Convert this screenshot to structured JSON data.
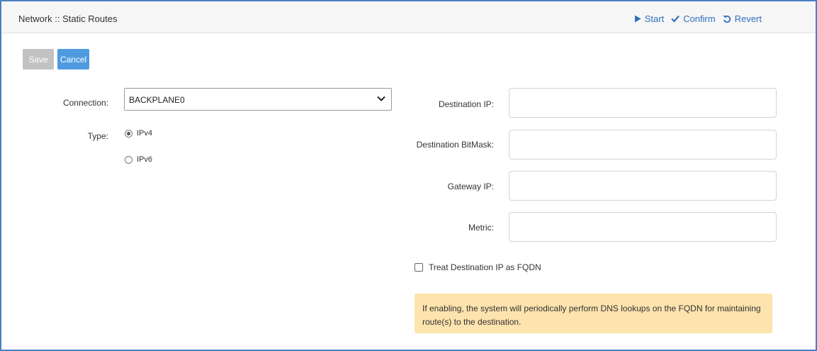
{
  "header": {
    "title": "Network :: Static Routes",
    "actions": [
      {
        "label": "Start",
        "icon": "play-icon"
      },
      {
        "label": "Confirm",
        "icon": "check-icon"
      },
      {
        "label": "Revert",
        "icon": "revert-icon"
      }
    ]
  },
  "toolbar": {
    "save_label": "Save",
    "cancel_label": "Cancel"
  },
  "form": {
    "connection_label": "Connection:",
    "connection_value": "BACKPLANE0",
    "type_label": "Type:",
    "type_options": [
      {
        "label": "IPv4",
        "checked": true
      },
      {
        "label": "IPv6",
        "checked": false
      }
    ],
    "destination_ip_label": "Destination IP:",
    "destination_ip_value": "",
    "destination_bitmask_label": "Destination BitMask:",
    "destination_bitmask_value": "",
    "gateway_ip_label": "Gateway IP:",
    "gateway_ip_value": "",
    "metric_label": "Metric:",
    "metric_value": "",
    "fqdn_checkbox_label": "Treat Destination IP as FQDN",
    "fqdn_checked": false,
    "fqdn_note": "If enabling, the system will periodically perform DNS lookups on the FQDN for maintaining route(s) to the destination."
  },
  "colors": {
    "accent": "#2f6fbf",
    "cancel_button": "#4f9be0",
    "save_button_disabled": "#c2c2c2",
    "note_background": "#fde3ad",
    "frame_border": "#4a7fc1"
  }
}
